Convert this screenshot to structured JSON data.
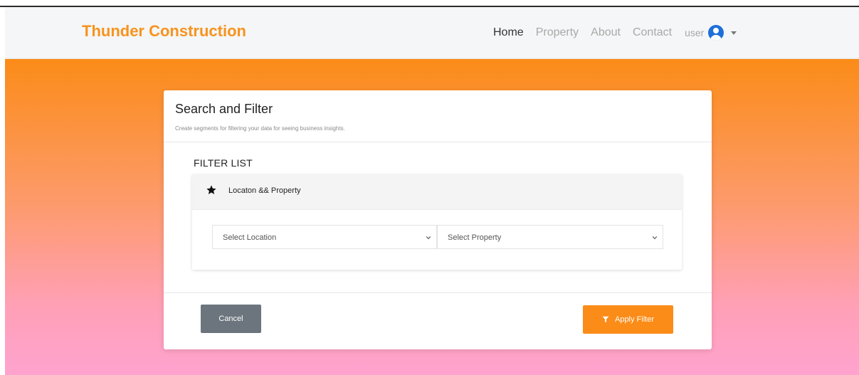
{
  "navbar": {
    "brand": "Thunder Construction",
    "links": [
      {
        "label": "Home",
        "active": true
      },
      {
        "label": "Property",
        "active": false
      },
      {
        "label": "About",
        "active": false
      },
      {
        "label": "Contact",
        "active": false
      }
    ],
    "user": {
      "label": "user",
      "icon": "user-circle-icon",
      "menu_icon": "caret-down-icon"
    }
  },
  "card": {
    "title": "Search and Filter",
    "subtitle": "Create segments for filtering your data for seeing business insights.",
    "filter_list_label": "FILTER LIST",
    "panel": {
      "icon": "star-icon",
      "title": "Locaton && Property",
      "location_select": {
        "value": "Select Location"
      },
      "property_select": {
        "value": "Select Property"
      }
    },
    "buttons": {
      "cancel": "Cancel",
      "apply": "Apply Filter",
      "apply_icon": "filter-icon"
    }
  },
  "colors": {
    "brand": "#f7931e",
    "primary": "#fb8c18",
    "secondary": "#6c757d",
    "avatar": "#1e6fd9"
  }
}
